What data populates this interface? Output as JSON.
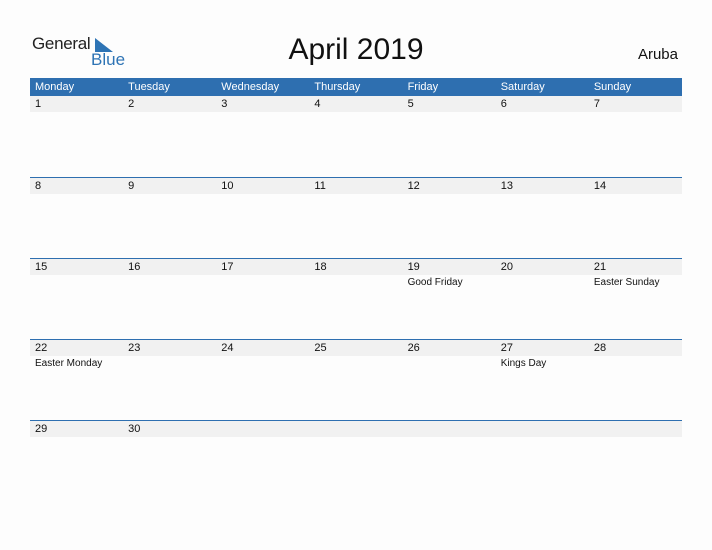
{
  "brand": {
    "word1": "General",
    "word2": "Blue"
  },
  "title": "April 2019",
  "country": "Aruba",
  "weekdays": [
    "Monday",
    "Tuesday",
    "Wednesday",
    "Thursday",
    "Friday",
    "Saturday",
    "Sunday"
  ],
  "weeks": [
    {
      "days": [
        "1",
        "2",
        "3",
        "4",
        "5",
        "6",
        "7"
      ],
      "events": [
        "",
        "",
        "",
        "",
        "",
        "",
        ""
      ]
    },
    {
      "days": [
        "8",
        "9",
        "10",
        "11",
        "12",
        "13",
        "14"
      ],
      "events": [
        "",
        "",
        "",
        "",
        "",
        "",
        ""
      ]
    },
    {
      "days": [
        "15",
        "16",
        "17",
        "18",
        "19",
        "20",
        "21"
      ],
      "events": [
        "",
        "",
        "",
        "",
        "Good Friday",
        "",
        "Easter Sunday"
      ]
    },
    {
      "days": [
        "22",
        "23",
        "24",
        "25",
        "26",
        "27",
        "28"
      ],
      "events": [
        "Easter Monday",
        "",
        "",
        "",
        "",
        "Kings Day",
        ""
      ]
    },
    {
      "days": [
        "29",
        "30",
        "",
        "",
        "",
        "",
        ""
      ],
      "events": [
        "",
        "",
        "",
        "",
        "",
        "",
        ""
      ]
    }
  ],
  "colors": {
    "accent": "#2e6fb0",
    "day_row_bg": "#f1f1f1"
  }
}
